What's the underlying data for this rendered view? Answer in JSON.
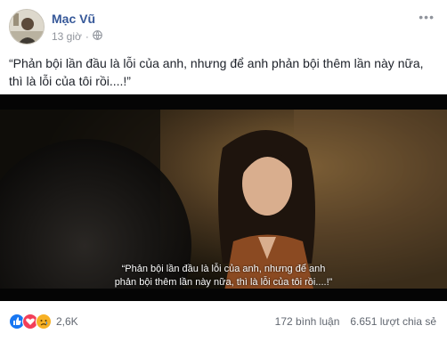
{
  "post": {
    "author": "Mạc Vũ",
    "time": "13 giờ",
    "text_line1": "“Phản bội lần đầu là lỗi của anh, nhưng để anh phản bội thêm lần này nữa,",
    "text_line2": "thì là lỗi của tôi rồi....!”"
  },
  "video": {
    "subtitle_line1": "“Phản bội lần đầu là lỗi của anh, nhưng để anh",
    "subtitle_line2": "phản bội thêm lần này nữa, thì là lỗi của tôi rồi....!”"
  },
  "footer": {
    "reaction_count": "2,6K",
    "comments": "172 bình luận",
    "shares": "6.651 lượt chia sẻ",
    "reaction_icons": [
      "like-icon",
      "love-icon",
      "sad-icon"
    ]
  },
  "colors": {
    "link": "#365899",
    "meta": "#90949c",
    "like": "#1877f2",
    "love": "#f33e58",
    "sad": "#f7b125"
  }
}
